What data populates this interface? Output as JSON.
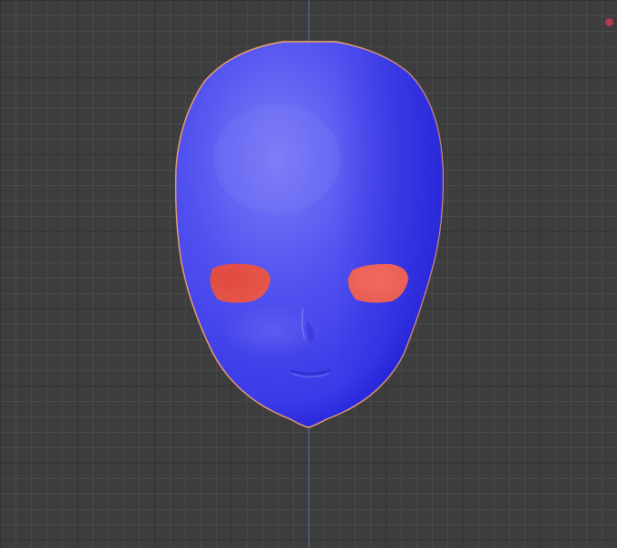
{
  "viewport": {
    "mode": "3d-view",
    "object": "head-mesh",
    "object_state": "selected"
  },
  "colors": {
    "background": "#3d3d3d",
    "grid_minor": "#4a4a4a",
    "grid_major": "#333333",
    "axis_y": "#4a6fa5",
    "mesh_face": "#4b4bf0",
    "mesh_highlight": "#7c7cf7",
    "mesh_shadow": "#1f1fd6",
    "selection_outline": "#f0a070",
    "eye_material": "#e85a50",
    "indicator": "#b23a4a"
  },
  "icons": {
    "indicator": "record-dot-icon"
  }
}
